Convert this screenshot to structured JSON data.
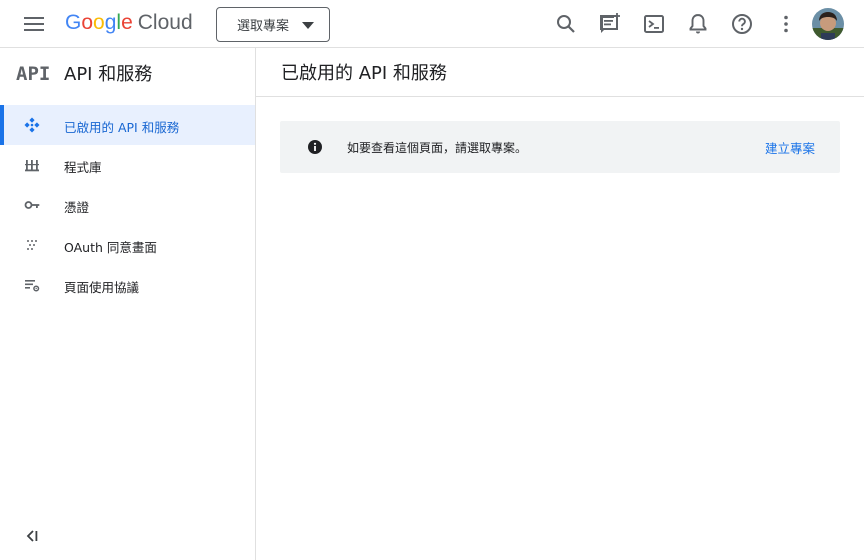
{
  "header": {
    "logo_google": "Google",
    "logo_cloud": "Cloud",
    "project_picker_label": "選取專案",
    "icons": [
      "menu-icon",
      "search-icon",
      "feedback-icon",
      "cloud-shell-icon",
      "notifications-icon",
      "help-icon",
      "more-vert-icon",
      "avatar"
    ]
  },
  "sidebar": {
    "logo_text": "API",
    "title": "API 和服務",
    "items": [
      {
        "label": "已啟用的 API 和服務",
        "icon": "api-diamond-icon",
        "active": true
      },
      {
        "label": "程式庫",
        "icon": "library-icon",
        "active": false
      },
      {
        "label": "憑證",
        "icon": "key-icon",
        "active": false
      },
      {
        "label": "OAuth 同意畫面",
        "icon": "oauth-dots-icon",
        "active": false
      },
      {
        "label": "頁面使用協議",
        "icon": "settings-list-icon",
        "active": false
      }
    ],
    "collapse_icon": "collapse-left-icon"
  },
  "main": {
    "page_title": "已啟用的 API 和服務",
    "banner": {
      "text": "如要查看這個頁面，請選取專案。",
      "link": "建立專案"
    }
  },
  "colors": {
    "accent": "#1a73e8",
    "active_bg": "#e8f0fe",
    "banner_bg": "#f1f3f4",
    "icon_gray": "#5f6368"
  }
}
